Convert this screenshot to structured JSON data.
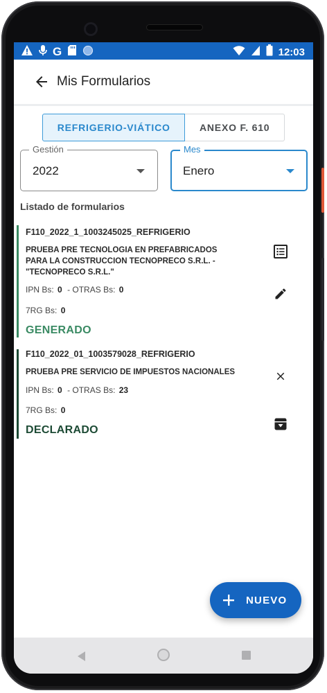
{
  "status_bar": {
    "time": "12:03",
    "left_icons": [
      "alert-icon",
      "mic-icon",
      "google-icon",
      "sd-card-icon",
      "circle-icon"
    ],
    "right_icons": [
      "wifi-icon",
      "signal-icon",
      "battery-icon"
    ]
  },
  "app_bar": {
    "title": "Mis Formularios",
    "back_icon": "arrow-back-icon"
  },
  "toggle": {
    "active_label": "REFRIGERIO-VIÁTICO",
    "inactive_label": "ANEXO F. 610"
  },
  "filters": {
    "gestion": {
      "label": "Gestión",
      "value": "2022"
    },
    "mes": {
      "label": "Mes",
      "value": "Enero"
    }
  },
  "list": {
    "title": "Listado de formularios",
    "items": [
      {
        "code": "F110_2022_1_1003245025_REFRIGERIO",
        "description": "PRUEBA PRE TECNOLOGIA EN PREFABRICADOS PARA LA CONSTRUCCION TECNOPRECO S.R.L. - \"TECNOPRECO S.R.L.\"",
        "ipn_label": "IPN Bs:",
        "ipn_value": "0",
        "otras_label": "- OTRAS Bs:",
        "otras_value": "0",
        "rg_label": "7RG Bs:",
        "rg_value": "0",
        "status": "GENERADO",
        "status_color": "#3a8a63",
        "icons": [
          "list-alt-icon",
          "edit-icon"
        ]
      },
      {
        "code": "F110_2022_01_1003579028_REFRIGERIO",
        "description": "PRUEBA PRE SERVICIO DE IMPUESTOS NACIONALES",
        "ipn_label": "IPN Bs:",
        "ipn_value": "0",
        "otras_label": "- OTRAS Bs:",
        "otras_value": "23",
        "rg_label": "7RG Bs:",
        "rg_value": "0",
        "status": "DECLARADO",
        "status_color": "#1c4a34",
        "icons": [
          "close-icon",
          "archive-icon"
        ]
      }
    ]
  },
  "fab": {
    "label": "NUEVO",
    "icon": "plus-icon"
  },
  "colors": {
    "primary": "#1565c0",
    "accent": "#3d9bd9",
    "generado": "#3a8a63",
    "declarado": "#1c4a34"
  },
  "nav_bar": {
    "icons": [
      "nav-back-icon",
      "nav-home-icon",
      "nav-recents-icon"
    ]
  }
}
